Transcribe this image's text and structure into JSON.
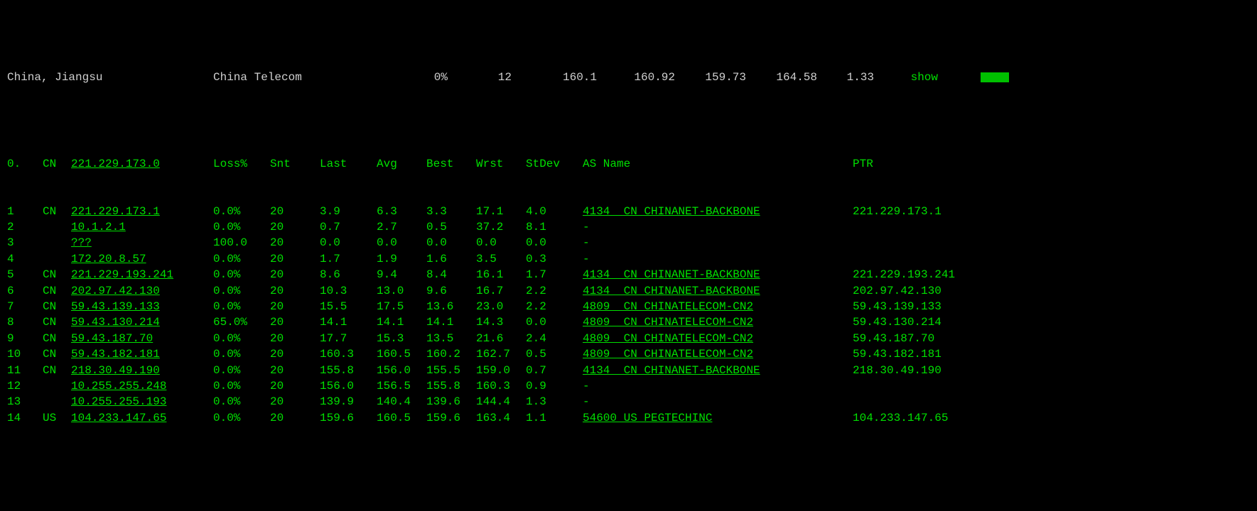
{
  "summary": {
    "location": "China, Jiangsu",
    "isp": "China Telecom",
    "loss": "0%",
    "snt": "12",
    "last": "160.1",
    "avg": "160.92",
    "best": "159.73",
    "wrst": "164.58",
    "stdev": "1.33",
    "show_label": "show"
  },
  "columns": {
    "hop": "0.",
    "cc": "CN",
    "ip": "221.229.173.0",
    "loss": "Loss%",
    "snt": "Snt",
    "last": "Last",
    "avg": "Avg",
    "best": "Best",
    "wrst": "Wrst",
    "stdev": "StDev",
    "asname": "AS Name",
    "ptr": "PTR"
  },
  "hops": [
    {
      "n": "1",
      "cc": "CN",
      "ip": "221.229.173.1",
      "loss": "0.0%",
      "snt": "20",
      "last": "3.9",
      "avg": "6.3",
      "best": "3.3",
      "wrst": "17.1",
      "stdev": "4.0",
      "as": "4134  CN CHINANET-BACKBONE",
      "ptr": "221.229.173.1",
      "as_und": true
    },
    {
      "n": "2",
      "cc": "",
      "ip": "10.1.2.1",
      "loss": "0.0%",
      "snt": "20",
      "last": "0.7",
      "avg": "2.7",
      "best": "0.5",
      "wrst": "37.2",
      "stdev": "8.1",
      "as": "-",
      "ptr": "",
      "as_und": false
    },
    {
      "n": "3",
      "cc": "",
      "ip": "???",
      "loss": "100.0",
      "snt": "20",
      "last": "0.0",
      "avg": "0.0",
      "best": "0.0",
      "wrst": "0.0",
      "stdev": "0.0",
      "as": "-",
      "ptr": "",
      "as_und": false
    },
    {
      "n": "4",
      "cc": "",
      "ip": "172.20.8.57",
      "loss": "0.0%",
      "snt": "20",
      "last": "1.7",
      "avg": "1.9",
      "best": "1.6",
      "wrst": "3.5",
      "stdev": "0.3",
      "as": "-",
      "ptr": "",
      "as_und": false
    },
    {
      "n": "5",
      "cc": "CN",
      "ip": "221.229.193.241",
      "loss": "0.0%",
      "snt": "20",
      "last": "8.6",
      "avg": "9.4",
      "best": "8.4",
      "wrst": "16.1",
      "stdev": "1.7",
      "as": "4134  CN CHINANET-BACKBONE",
      "ptr": "221.229.193.241",
      "as_und": true
    },
    {
      "n": "6",
      "cc": "CN",
      "ip": "202.97.42.130",
      "loss": "0.0%",
      "snt": "20",
      "last": "10.3",
      "avg": "13.0",
      "best": "9.6",
      "wrst": "16.7",
      "stdev": "2.2",
      "as": "4134  CN CHINANET-BACKBONE",
      "ptr": "202.97.42.130",
      "as_und": true
    },
    {
      "n": "7",
      "cc": "CN",
      "ip": "59.43.139.133",
      "loss": "0.0%",
      "snt": "20",
      "last": "15.5",
      "avg": "17.5",
      "best": "13.6",
      "wrst": "23.0",
      "stdev": "2.2",
      "as": "4809  CN CHINATELECOM-CN2",
      "ptr": "59.43.139.133",
      "as_und": true
    },
    {
      "n": "8",
      "cc": "CN",
      "ip": "59.43.130.214",
      "loss": "65.0%",
      "snt": "20",
      "last": "14.1",
      "avg": "14.1",
      "best": "14.1",
      "wrst": "14.3",
      "stdev": "0.0",
      "as": "4809  CN CHINATELECOM-CN2",
      "ptr": "59.43.130.214",
      "as_und": true
    },
    {
      "n": "9",
      "cc": "CN",
      "ip": "59.43.187.70",
      "loss": "0.0%",
      "snt": "20",
      "last": "17.7",
      "avg": "15.3",
      "best": "13.5",
      "wrst": "21.6",
      "stdev": "2.4",
      "as": "4809  CN CHINATELECOM-CN2",
      "ptr": "59.43.187.70",
      "as_und": true
    },
    {
      "n": "10",
      "cc": "CN",
      "ip": "59.43.182.181",
      "loss": "0.0%",
      "snt": "20",
      "last": "160.3",
      "avg": "160.5",
      "best": "160.2",
      "wrst": "162.7",
      "stdev": "0.5",
      "as": "4809  CN CHINATELECOM-CN2",
      "ptr": "59.43.182.181",
      "as_und": true
    },
    {
      "n": "11",
      "cc": "CN",
      "ip": "218.30.49.190",
      "loss": "0.0%",
      "snt": "20",
      "last": "155.8",
      "avg": "156.0",
      "best": "155.5",
      "wrst": "159.0",
      "stdev": "0.7",
      "as": "4134  CN CHINANET-BACKBONE",
      "ptr": "218.30.49.190",
      "as_und": true
    },
    {
      "n": "12",
      "cc": "",
      "ip": "10.255.255.248",
      "loss": "0.0%",
      "snt": "20",
      "last": "156.0",
      "avg": "156.5",
      "best": "155.8",
      "wrst": "160.3",
      "stdev": "0.9",
      "as": "-",
      "ptr": "",
      "as_und": false
    },
    {
      "n": "13",
      "cc": "",
      "ip": "10.255.255.193",
      "loss": "0.0%",
      "snt": "20",
      "last": "139.9",
      "avg": "140.4",
      "best": "139.6",
      "wrst": "144.4",
      "stdev": "1.3",
      "as": "-",
      "ptr": "",
      "as_und": false
    },
    {
      "n": "14",
      "cc": "US",
      "ip": "104.233.147.65",
      "loss": "0.0%",
      "snt": "20",
      "last": "159.6",
      "avg": "160.5",
      "best": "159.6",
      "wrst": "163.4",
      "stdev": "1.1",
      "as": "54600 US PEGTECHINC",
      "ptr": "104.233.147.65",
      "as_und": true
    }
  ]
}
